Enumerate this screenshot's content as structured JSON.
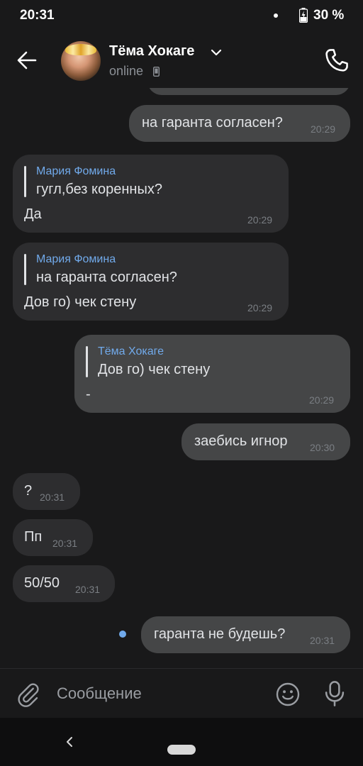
{
  "status_bar": {
    "time": "20:31",
    "battery": "30 %"
  },
  "header": {
    "name": "Тёма Хокаге",
    "status": "online"
  },
  "messages": [
    {
      "dir": "out",
      "text": "на гаранта согласен?",
      "time": "20:29"
    },
    {
      "dir": "in",
      "reply_author": "Мария Фомина",
      "reply_text": "гугл,без коренных?",
      "text": "Да",
      "time": "20:29"
    },
    {
      "dir": "in",
      "reply_author": "Мария Фомина",
      "reply_text": "на гаранта согласен?",
      "text": "Дов го) чек стену",
      "time": "20:29"
    },
    {
      "dir": "out",
      "reply_author": "Тёма Хокаге",
      "reply_text": "Дов го) чек стену",
      "text": "-",
      "time": "20:29"
    },
    {
      "dir": "out",
      "text": "заебись игнор",
      "time": "20:30"
    },
    {
      "dir": "in",
      "text": "?",
      "time": "20:31"
    },
    {
      "dir": "in",
      "text": "Пп",
      "time": "20:31"
    },
    {
      "dir": "in",
      "text": "50/50",
      "time": "20:31"
    },
    {
      "dir": "out",
      "text": "гаранта не будешь?",
      "time": "20:31",
      "unread": true
    }
  ],
  "composer": {
    "placeholder": "Сообщение"
  },
  "icons": {
    "back": "arrow-left-icon",
    "call": "phone-icon",
    "attach": "paperclip-icon",
    "emoji": "smiley-icon",
    "mic": "microphone-icon",
    "battery": "battery-charging-icon",
    "online_device": "mobile-phone-icon",
    "chevron": "chevron-down-icon"
  },
  "colors": {
    "background": "#19191a",
    "bubble_in": "#2d2d2f",
    "bubble_out": "#454647",
    "accent": "#71aaeb"
  }
}
